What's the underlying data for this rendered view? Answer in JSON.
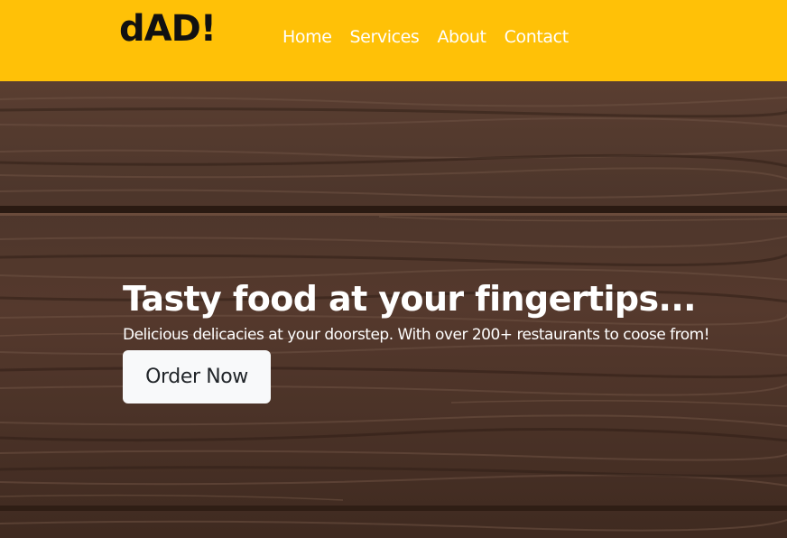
{
  "brand": {
    "logo_text": "dAD!",
    "accent_color": "#FFC107"
  },
  "nav": {
    "items": [
      {
        "label": "Home"
      },
      {
        "label": "Services"
      },
      {
        "label": "About"
      },
      {
        "label": "Contact"
      }
    ]
  },
  "hero": {
    "title": "Tasty food at your fingertips...",
    "subtitle": "Delicious delicacies at your doorstep. With over 200+ restaurants to coose from!",
    "cta_label": "Order Now",
    "background": "wood-texture"
  }
}
